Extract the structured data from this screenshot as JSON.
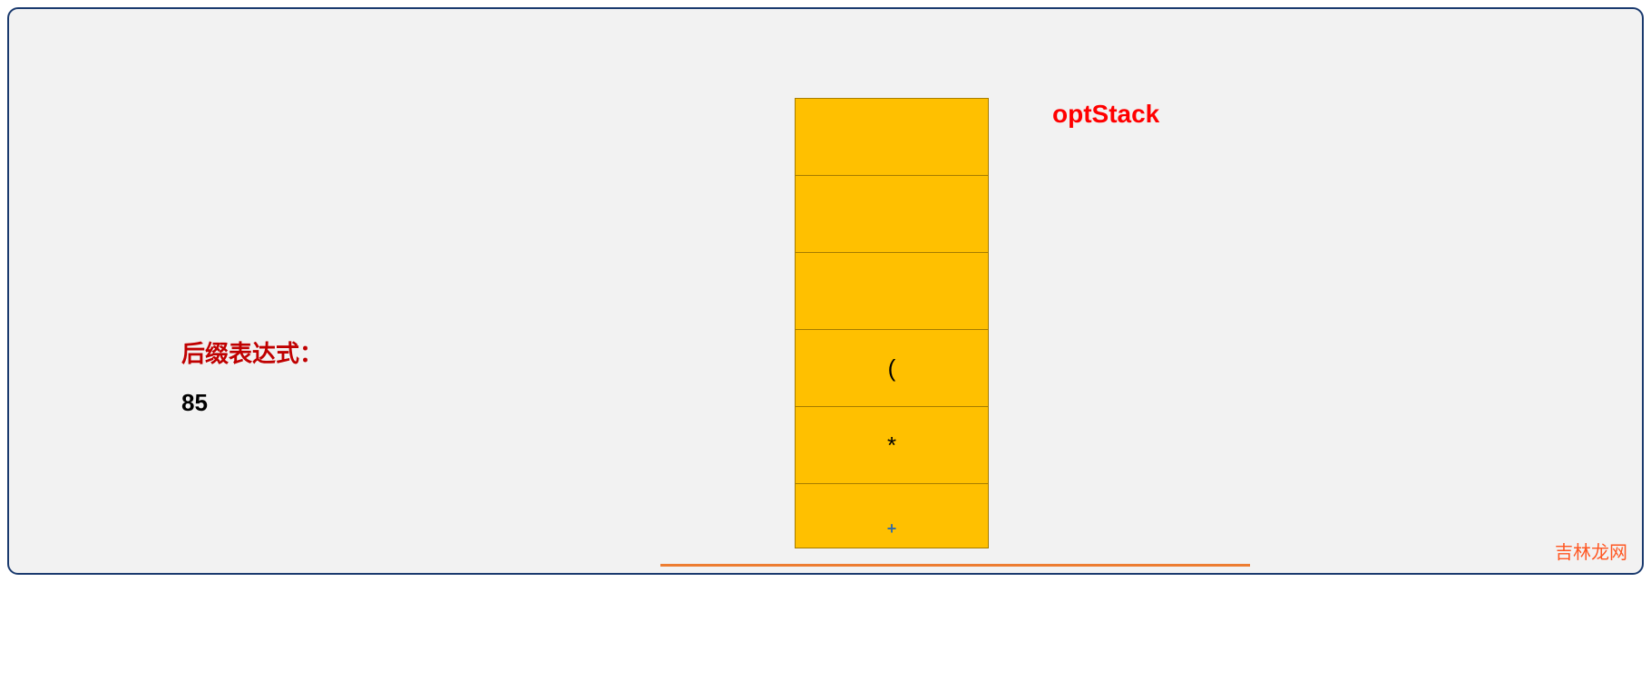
{
  "postfix": {
    "label": "后缀表达式：",
    "value": "85"
  },
  "stack": {
    "title": "optStack",
    "cells": [
      "",
      "",
      "",
      "(",
      "*",
      "+"
    ]
  },
  "watermark": "吉林龙网"
}
